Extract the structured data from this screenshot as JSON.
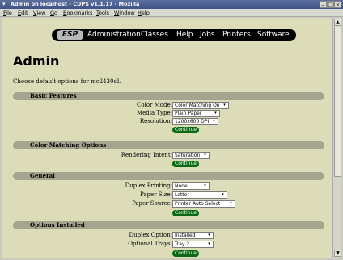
{
  "window": {
    "title": "Admin on localhost - CUPS v1.1.17 - Mozilla"
  },
  "menu": {
    "items": [
      "File",
      "Edit",
      "View",
      "Go",
      "Bookmarks",
      "Tools",
      "Window",
      "Help"
    ]
  },
  "navbar": {
    "logo": "ESP",
    "items": [
      "Administration",
      "Classes",
      "Help",
      "Jobs",
      "Printers",
      "Software"
    ]
  },
  "page": {
    "title": "Admin",
    "intro": "Choose default options for mc2430dl."
  },
  "sections": [
    {
      "title": "Basic Features"
    },
    {
      "title": "Color Matching Options"
    },
    {
      "title": "General"
    },
    {
      "title": "Options Installed"
    }
  ],
  "options": {
    "color_mode": {
      "label": "Color Mode:",
      "value": "Color Matching On"
    },
    "media_type": {
      "label": "Media Type:",
      "value": "Plain Paper"
    },
    "resolution": {
      "label": "Resolution:",
      "value": "1200x600 DPI"
    },
    "rendering_intent": {
      "label": "Rendering Intent:",
      "value": "Saturation"
    },
    "duplex_printing": {
      "label": "Duplex Printing:",
      "value": "None"
    },
    "paper_size": {
      "label": "Paper Size:",
      "value": "Letter"
    },
    "paper_source": {
      "label": "Paper Source:",
      "value": "Printer Auto Select"
    },
    "duplex_option": {
      "label": "Duplex Option:",
      "value": "Installed"
    },
    "optional_trays": {
      "label": "Optional Trays:",
      "value": "Tray 2"
    }
  },
  "buttons": {
    "continue": "Continue"
  },
  "colors": {
    "section_bg": "#a5a48f",
    "content_bg": "#dcdcb8",
    "button_bg": "#0a6a14"
  }
}
